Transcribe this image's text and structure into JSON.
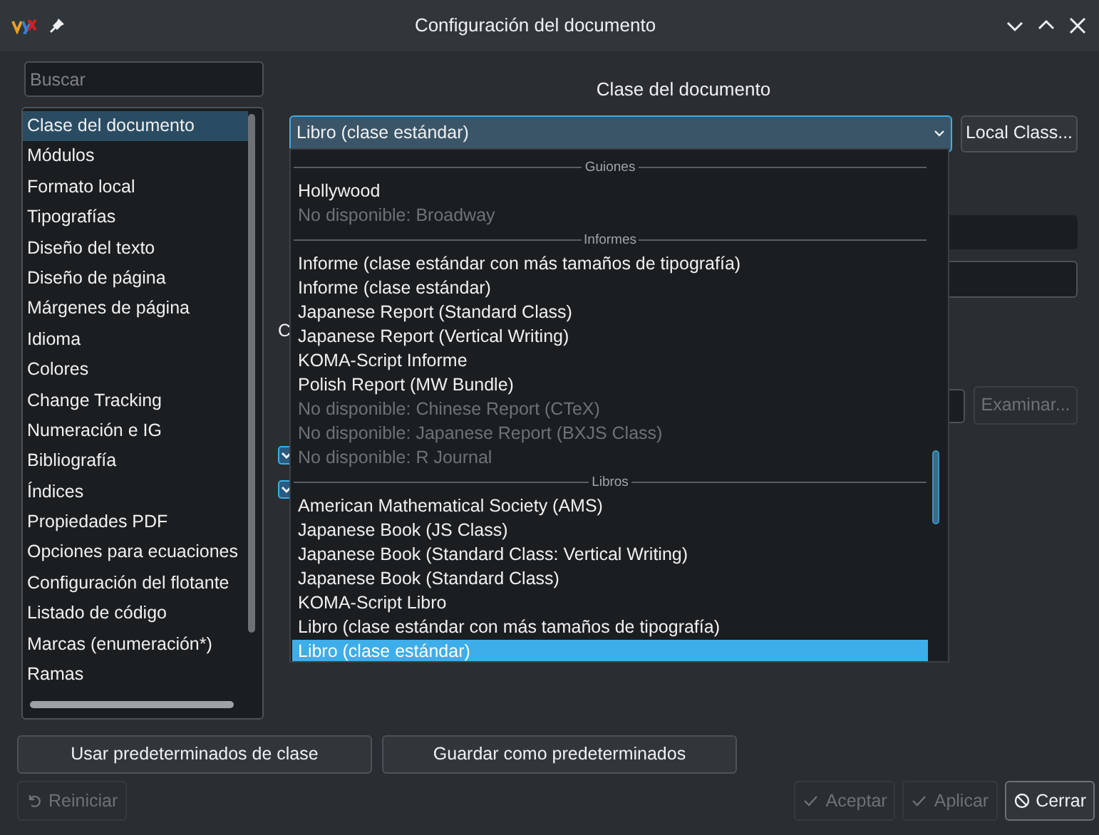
{
  "window": {
    "title": "Configuración del documento"
  },
  "sidebar": {
    "search": {
      "placeholder": "Buscar"
    },
    "items": [
      {
        "label": "Clase del documento",
        "selected": true
      },
      {
        "label": "Módulos",
        "selected": false
      },
      {
        "label": "Formato local",
        "selected": false
      },
      {
        "label": "Tipografías",
        "selected": false
      },
      {
        "label": "Diseño del texto",
        "selected": false
      },
      {
        "label": "Diseño de página",
        "selected": false
      },
      {
        "label": "Márgenes de página",
        "selected": false
      },
      {
        "label": "Idioma",
        "selected": false
      },
      {
        "label": "Colores",
        "selected": false
      },
      {
        "label": "Change Tracking",
        "selected": false
      },
      {
        "label": "Numeración e IG",
        "selected": false
      },
      {
        "label": "Bibliografía",
        "selected": false
      },
      {
        "label": "Índices",
        "selected": false
      },
      {
        "label": "Propiedades PDF",
        "selected": false
      },
      {
        "label": "Opciones para ecuaciones",
        "selected": false
      },
      {
        "label": "Configuración del flotante",
        "selected": false
      },
      {
        "label": "Listado de código",
        "selected": false
      },
      {
        "label": "Marcas (enumeración*)",
        "selected": false
      },
      {
        "label": "Ramas",
        "selected": false
      }
    ]
  },
  "heading": "Clase del documento",
  "class_combo": {
    "value": "Libro (clase estándar)"
  },
  "local_class_button": "Local Class...",
  "dropdown": {
    "groups": [
      {
        "heading": "Guiones",
        "items": [
          {
            "label": "Hollywood",
            "disabled": false,
            "selected": false
          },
          {
            "label": "No disponible: Broadway",
            "disabled": true,
            "selected": false
          }
        ]
      },
      {
        "heading": "Informes",
        "items": [
          {
            "label": "Informe (clase estándar con más tamaños de tipografía)",
            "disabled": false,
            "selected": false
          },
          {
            "label": "Informe (clase estándar)",
            "disabled": false,
            "selected": false
          },
          {
            "label": "Japanese Report (Standard Class)",
            "disabled": false,
            "selected": false
          },
          {
            "label": "Japanese Report (Vertical Writing)",
            "disabled": false,
            "selected": false
          },
          {
            "label": "KOMA-Script Informe",
            "disabled": false,
            "selected": false
          },
          {
            "label": "Polish Report (MW Bundle)",
            "disabled": false,
            "selected": false
          },
          {
            "label": "No disponible: Chinese Report (CTeX)",
            "disabled": true,
            "selected": false
          },
          {
            "label": "No disponible: Japanese Report (BXJS Class)",
            "disabled": true,
            "selected": false
          },
          {
            "label": "No disponible: R Journal",
            "disabled": true,
            "selected": false
          }
        ]
      },
      {
        "heading": "Libros",
        "items": [
          {
            "label": "American Mathematical Society (AMS)",
            "disabled": false,
            "selected": false
          },
          {
            "label": "Japanese Book (JS Class)",
            "disabled": false,
            "selected": false
          },
          {
            "label": "Japanese Book (Standard Class: Vertical Writing)",
            "disabled": false,
            "selected": false
          },
          {
            "label": "Japanese Book (Standard Class)",
            "disabled": false,
            "selected": false
          },
          {
            "label": "KOMA-Script Libro",
            "disabled": false,
            "selected": false
          },
          {
            "label": "Libro (clase estándar con más tamaños de tipografía)",
            "disabled": false,
            "selected": false
          },
          {
            "label": "Libro (clase estándar)",
            "disabled": false,
            "selected": true
          }
        ]
      }
    ]
  },
  "hidden_label_fragment": "C",
  "browse_button": {
    "label": "Examinar...",
    "disabled": true
  },
  "checkboxes": [
    {
      "checked": true
    },
    {
      "checked": true
    }
  ],
  "default_buttons": [
    "Usar predeterminados de clase",
    "Guardar como predeterminados"
  ],
  "footer_buttons": [
    {
      "label": "Reiniciar",
      "kind": "reset",
      "disabled": true
    },
    {
      "label": "Aceptar",
      "kind": "check",
      "disabled": true
    },
    {
      "label": "Aplicar",
      "kind": "check",
      "disabled": true
    },
    {
      "label": "Cerrar",
      "kind": "cancel",
      "disabled": false
    }
  ]
}
